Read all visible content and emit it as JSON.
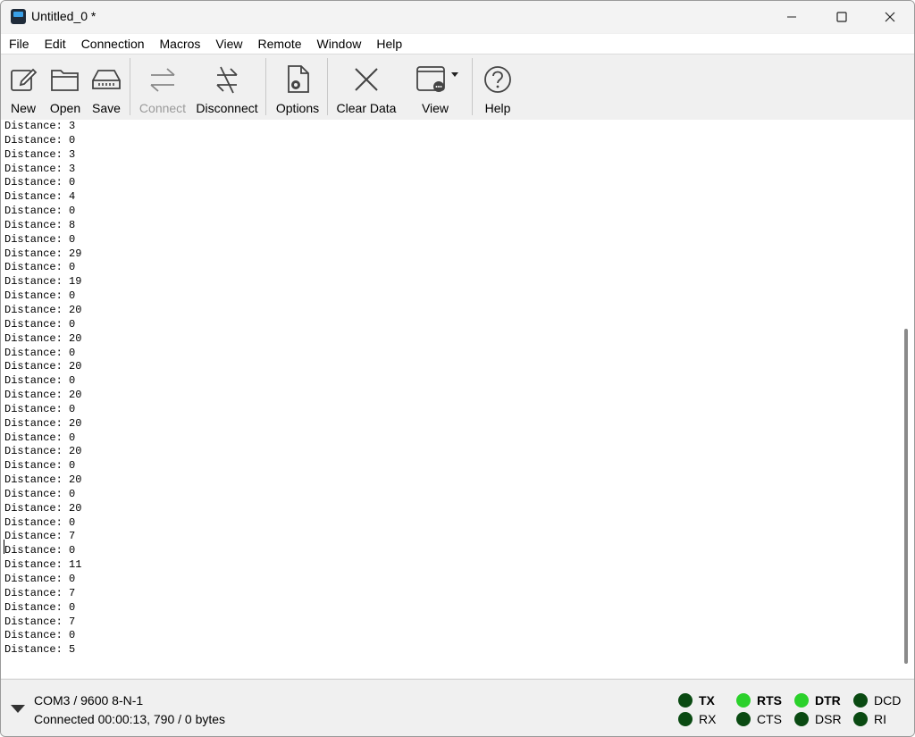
{
  "window": {
    "title": "Untitled_0 *"
  },
  "menu": [
    "File",
    "Edit",
    "Connection",
    "Macros",
    "View",
    "Remote",
    "Window",
    "Help"
  ],
  "toolbar": {
    "new": "New",
    "open": "Open",
    "save": "Save",
    "connect": "Connect",
    "disconnect": "Disconnect",
    "options": "Options",
    "clear": "Clear Data",
    "view": "View",
    "help": "Help"
  },
  "terminal": {
    "lines": [
      "Distance: 3",
      "Distance: 0",
      "Distance: 3",
      "Distance: 3",
      "Distance: 0",
      "Distance: 4",
      "Distance: 0",
      "Distance: 8",
      "Distance: 0",
      "Distance: 29",
      "Distance: 0",
      "Distance: 19",
      "Distance: 0",
      "Distance: 20",
      "Distance: 0",
      "Distance: 20",
      "Distance: 0",
      "Distance: 20",
      "Distance: 0",
      "Distance: 20",
      "Distance: 0",
      "Distance: 20",
      "Distance: 0",
      "Distance: 20",
      "Distance: 0",
      "Distance: 20",
      "Distance: 0",
      "Distance: 20",
      "Distance: 0",
      "Distance: 7",
      "Distance: 0",
      "Distance: 11",
      "Distance: 0",
      "Distance: 7",
      "Distance: 0",
      "Distance: 7",
      "Distance: 0",
      "Distance: 5"
    ]
  },
  "status": {
    "port": "COM3 / 9600 8-N-1",
    "connection": "Connected 00:00:13, 790 / 0 bytes",
    "leds": {
      "tx": "TX",
      "rx": "RX",
      "rts": "RTS",
      "cts": "CTS",
      "dtr": "DTR",
      "dsr": "DSR",
      "dcd": "DCD",
      "ri": "RI"
    }
  },
  "colors": {
    "led_on": "#2bd12b",
    "led_off": "#0a4a12"
  }
}
